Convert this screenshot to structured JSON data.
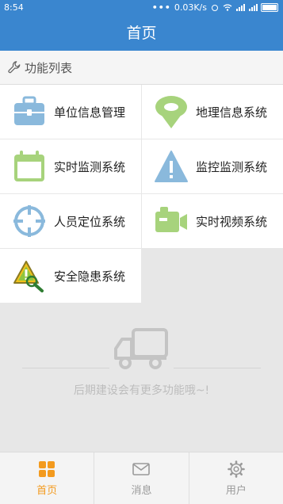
{
  "status": {
    "time": "8:54",
    "network": "0.03K/s"
  },
  "header": {
    "title": "首页"
  },
  "section": {
    "title": "功能列表"
  },
  "tiles": [
    {
      "label": "单位信息管理",
      "icon": "briefcase-icon"
    },
    {
      "label": "地理信息系统",
      "icon": "map-pin-icon"
    },
    {
      "label": "实时监测系统",
      "icon": "calendar-icon"
    },
    {
      "label": "监控监测系统",
      "icon": "warning-icon"
    },
    {
      "label": "人员定位系统",
      "icon": "crosshair-icon"
    },
    {
      "label": "实时视频系统",
      "icon": "video-camera-icon"
    },
    {
      "label": "安全隐患系统",
      "icon": "hazard-search-icon"
    }
  ],
  "empty_state": {
    "message": "后期建设会有更多功能哦~!",
    "icon": "truck-icon"
  },
  "tabs": [
    {
      "label": "首页",
      "icon": "grid-icon",
      "active": true
    },
    {
      "label": "消息",
      "icon": "mail-icon",
      "active": false
    },
    {
      "label": "用户",
      "icon": "gear-icon",
      "active": false
    }
  ],
  "colors": {
    "primary": "#3a86cf",
    "accent": "#f39a1e",
    "green": "#a7d37c",
    "blue": "#8ab9dc"
  }
}
